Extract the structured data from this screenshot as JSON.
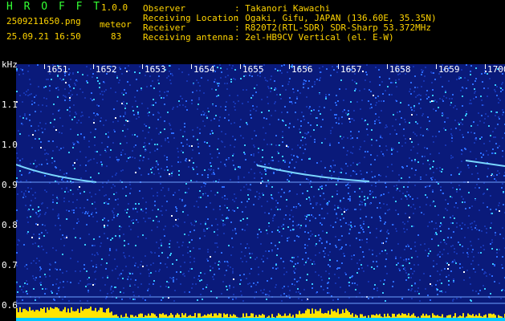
{
  "app": {
    "logo": "H R O F F T",
    "version": "1.0.0",
    "filename": "2509211650.png",
    "datetime": "25.09.21 16:50",
    "mode": "meteor",
    "count": "83"
  },
  "info": {
    "observer_label": "Observer",
    "observer_value": ": Takanori Kawachi",
    "location_label": "Receiving Location",
    "location_value": ": Ogaki, Gifu, JAPAN (136.60E, 35.35N)",
    "receiver_label": "Receiver",
    "receiver_value": ": R820T2(RTL-SDR) SDR-Sharp 53.372MHz",
    "antenna_label": "Receiving antenna",
    "antenna_value": ": 2el-HB9CV Vertical (el. E-W)"
  },
  "axes": {
    "y_unit": "kHz",
    "x_ticks": [
      "1651",
      "1652",
      "1653",
      "1654",
      "1655",
      "1656",
      "1657",
      "1658",
      "1659",
      "1700"
    ],
    "y_ticks": [
      "1.1",
      "1.0",
      "0.9",
      "0.8",
      "0.7",
      "0.6"
    ]
  },
  "colors": {
    "background": "#0a1a7a",
    "trail": "#7ad7ff",
    "bars": "#ffe400",
    "bars_base": "#00c8ff"
  }
}
